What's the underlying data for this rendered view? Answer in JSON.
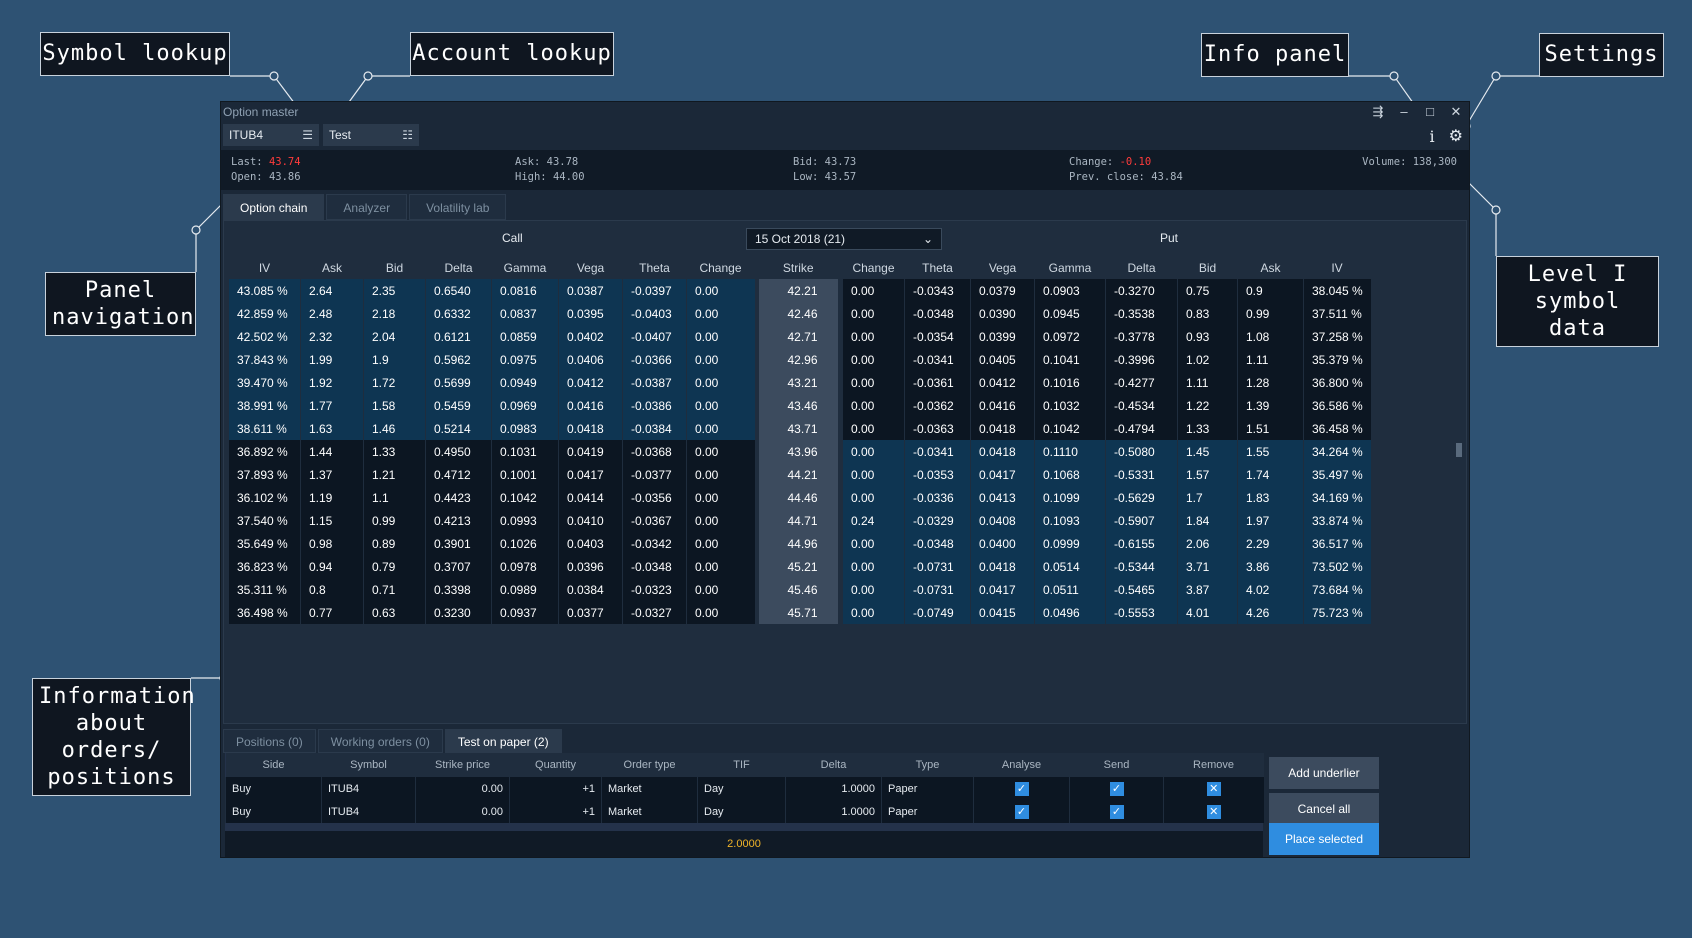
{
  "callouts": {
    "symbol_lookup": "Symbol lookup",
    "account_lookup": "Account lookup",
    "info_panel": "Info panel",
    "settings": "Settings",
    "panel_navigation": [
      "Panel",
      "navigation"
    ],
    "level1": [
      "Level I",
      "symbol data"
    ],
    "orders_info": [
      "Information",
      "about",
      "orders/",
      "positions"
    ]
  },
  "window": {
    "title": "Option master"
  },
  "toolbar": {
    "symbol": "ITUB4",
    "account": "Test",
    "info_icon": "i"
  },
  "quote": {
    "last_label": "Last:",
    "last": "43.74",
    "open_label": "Open:",
    "open": "43.86",
    "ask_label": "Ask:",
    "ask": "43.78",
    "high_label": "High:",
    "high": "44.00",
    "bid_label": "Bid:",
    "bid": "43.73",
    "low_label": "Low:",
    "low": "43.57",
    "change_label": "Change:",
    "change": "-0.10",
    "prev_close_label": "Prev. close:",
    "prev_close": "43.84",
    "volume_label": "Volume:",
    "volume": "138,300"
  },
  "tabs": [
    "Option chain",
    "Analyzer",
    "Volatility lab"
  ],
  "chain": {
    "call_label": "Call",
    "put_label": "Put",
    "expiration": "15 Oct 2018 (21)",
    "call_headers": [
      "IV",
      "Ask",
      "Bid",
      "Delta",
      "Gamma",
      "Vega",
      "Theta",
      "Change"
    ],
    "strike_header": "Strike",
    "put_headers": [
      "Change",
      "Theta",
      "Vega",
      "Gamma",
      "Delta",
      "Bid",
      "Ask",
      "IV"
    ],
    "strikes": [
      "42.21",
      "42.46",
      "42.71",
      "42.96",
      "43.21",
      "43.46",
      "43.71",
      "43.96",
      "44.21",
      "44.46",
      "44.71",
      "44.96",
      "45.21",
      "45.46",
      "45.71"
    ],
    "calls": [
      [
        "43.085 %",
        "2.64",
        "2.35",
        "0.6540",
        "0.0816",
        "0.0387",
        "-0.0397",
        "0.00"
      ],
      [
        "42.859 %",
        "2.48",
        "2.18",
        "0.6332",
        "0.0837",
        "0.0395",
        "-0.0403",
        "0.00"
      ],
      [
        "42.502 %",
        "2.32",
        "2.04",
        "0.6121",
        "0.0859",
        "0.0402",
        "-0.0407",
        "0.00"
      ],
      [
        "37.843 %",
        "1.99",
        "1.9",
        "0.5962",
        "0.0975",
        "0.0406",
        "-0.0366",
        "0.00"
      ],
      [
        "39.470 %",
        "1.92",
        "1.72",
        "0.5699",
        "0.0949",
        "0.0412",
        "-0.0387",
        "0.00"
      ],
      [
        "38.991 %",
        "1.77",
        "1.58",
        "0.5459",
        "0.0969",
        "0.0416",
        "-0.0386",
        "0.00"
      ],
      [
        "38.611 %",
        "1.63",
        "1.46",
        "0.5214",
        "0.0983",
        "0.0418",
        "-0.0384",
        "0.00"
      ],
      [
        "36.892 %",
        "1.44",
        "1.33",
        "0.4950",
        "0.1031",
        "0.0419",
        "-0.0368",
        "0.00"
      ],
      [
        "37.893 %",
        "1.37",
        "1.21",
        "0.4712",
        "0.1001",
        "0.0417",
        "-0.0377",
        "0.00"
      ],
      [
        "36.102 %",
        "1.19",
        "1.1",
        "0.4423",
        "0.1042",
        "0.0414",
        "-0.0356",
        "0.00"
      ],
      [
        "37.540 %",
        "1.15",
        "0.99",
        "0.4213",
        "0.0993",
        "0.0410",
        "-0.0367",
        "0.00"
      ],
      [
        "35.649 %",
        "0.98",
        "0.89",
        "0.3901",
        "0.1026",
        "0.0403",
        "-0.0342",
        "0.00"
      ],
      [
        "36.823 %",
        "0.94",
        "0.79",
        "0.3707",
        "0.0978",
        "0.0396",
        "-0.0348",
        "0.00"
      ],
      [
        "35.311 %",
        "0.8",
        "0.71",
        "0.3398",
        "0.0989",
        "0.0384",
        "-0.0323",
        "0.00"
      ],
      [
        "36.498 %",
        "0.77",
        "0.63",
        "0.3230",
        "0.0937",
        "0.0377",
        "-0.0327",
        "0.00"
      ]
    ],
    "call_colors": [
      [
        "r",
        "r",
        "r",
        "g",
        "g",
        "g",
        "g",
        "w"
      ],
      [
        "r",
        "r",
        "r",
        "g",
        "g",
        "g",
        "g",
        "w"
      ],
      [
        "r",
        "r",
        "r",
        "g",
        "g",
        "g",
        "g",
        "w"
      ],
      [
        "g",
        "w",
        "g",
        "r",
        "r",
        "w",
        "r",
        "w"
      ],
      [
        "g",
        "w",
        "r",
        "r",
        "r",
        "w",
        "r",
        "w"
      ],
      [
        "g",
        "w",
        "r",
        "r",
        "r",
        "w",
        "r",
        "w"
      ],
      [
        "g",
        "w",
        "g",
        "r",
        "r",
        "w",
        "r",
        "w"
      ],
      [
        "g",
        "w",
        "w",
        "r",
        "r",
        "w",
        "r",
        "w"
      ],
      [
        "g",
        "w",
        "w",
        "r",
        "r",
        "r",
        "r",
        "w"
      ],
      [
        "g",
        "w",
        "w",
        "r",
        "r",
        "r",
        "r",
        "w"
      ],
      [
        "g",
        "g",
        "w",
        "g",
        "r",
        "w",
        "r",
        "w"
      ],
      [
        "g",
        "w",
        "w",
        "r",
        "r",
        "w",
        "r",
        "w"
      ],
      [
        "g",
        "w",
        "w",
        "r",
        "r",
        "r",
        "r",
        "w"
      ],
      [
        "g",
        "w",
        "w",
        "r",
        "r",
        "r",
        "r",
        "w"
      ],
      [
        "g",
        "w",
        "w",
        "r",
        "r",
        "r",
        "r",
        "w"
      ]
    ],
    "puts": [
      [
        "0.00",
        "-0.0343",
        "0.0379",
        "0.0903",
        "-0.3270",
        "0.75",
        "0.9",
        "38.045 %"
      ],
      [
        "0.00",
        "-0.0348",
        "0.0390",
        "0.0945",
        "-0.3538",
        "0.83",
        "0.99",
        "37.511 %"
      ],
      [
        "0.00",
        "-0.0354",
        "0.0399",
        "0.0972",
        "-0.3778",
        "0.93",
        "1.08",
        "37.258 %"
      ],
      [
        "0.00",
        "-0.0341",
        "0.0405",
        "0.1041",
        "-0.3996",
        "1.02",
        "1.11",
        "35.379 %"
      ],
      [
        "0.00",
        "-0.0361",
        "0.0412",
        "0.1016",
        "-0.4277",
        "1.11",
        "1.28",
        "36.800 %"
      ],
      [
        "0.00",
        "-0.0362",
        "0.0416",
        "0.1032",
        "-0.4534",
        "1.22",
        "1.39",
        "36.586 %"
      ],
      [
        "0.00",
        "-0.0363",
        "0.0418",
        "0.1042",
        "-0.4794",
        "1.33",
        "1.51",
        "36.458 %"
      ],
      [
        "0.00",
        "-0.0341",
        "0.0418",
        "0.1110",
        "-0.5080",
        "1.45",
        "1.55",
        "34.264 %"
      ],
      [
        "0.00",
        "-0.0353",
        "0.0417",
        "0.1068",
        "-0.5331",
        "1.57",
        "1.74",
        "35.497 %"
      ],
      [
        "0.00",
        "-0.0336",
        "0.0413",
        "0.1099",
        "-0.5629",
        "1.7",
        "1.83",
        "34.169 %"
      ],
      [
        "0.24",
        "-0.0329",
        "0.0408",
        "0.1093",
        "-0.5907",
        "1.84",
        "1.97",
        "33.874 %"
      ],
      [
        "0.00",
        "-0.0348",
        "0.0400",
        "0.0999",
        "-0.6155",
        "2.06",
        "2.29",
        "36.517 %"
      ],
      [
        "0.00",
        "-0.0731",
        "0.0418",
        "0.0514",
        "-0.5344",
        "3.71",
        "3.86",
        "73.502 %"
      ],
      [
        "0.00",
        "-0.0731",
        "0.0417",
        "0.0511",
        "-0.5465",
        "3.87",
        "4.02",
        "73.684 %"
      ],
      [
        "0.00",
        "-0.0749",
        "0.0415",
        "0.0496",
        "-0.5553",
        "4.01",
        "4.26",
        "75.723 %"
      ]
    ],
    "put_colors": [
      [
        "w",
        "w",
        "w",
        "w",
        "w",
        "w",
        "w",
        "w"
      ],
      [
        "w",
        "g",
        "g",
        "g",
        "r",
        "r",
        "g",
        "r"
      ],
      [
        "w",
        "r",
        "g",
        "w",
        "r",
        "w",
        "g",
        "w"
      ],
      [
        "w",
        "g",
        "w",
        "g",
        "r",
        "w",
        "w",
        "r"
      ],
      [
        "w",
        "r",
        "g",
        "w",
        "r",
        "r",
        "g",
        "w"
      ],
      [
        "w",
        "w",
        "w",
        "w",
        "r",
        "w",
        "g",
        "w"
      ],
      [
        "w",
        "g",
        "w",
        "g",
        "r",
        "w",
        "g",
        "r"
      ],
      [
        "w",
        "g",
        "r",
        "g",
        "r",
        "w",
        "w",
        "r"
      ],
      [
        "w",
        "g",
        "r",
        "g",
        "r",
        "w",
        "r",
        "r"
      ],
      [
        "w",
        "g",
        "r",
        "w",
        "r",
        "w",
        "g",
        "r"
      ],
      [
        "w",
        "g",
        "w",
        "w",
        "r",
        "w",
        "g",
        "r"
      ],
      [
        "w",
        "w",
        "w",
        "w",
        "w",
        "w",
        "w",
        "w"
      ],
      [
        "w",
        "w",
        "w",
        "w",
        "w",
        "w",
        "w",
        "w"
      ],
      [
        "w",
        "w",
        "w",
        "w",
        "w",
        "w",
        "w",
        "w"
      ],
      [
        "w",
        "w",
        "w",
        "w",
        "w",
        "w",
        "w",
        "w"
      ]
    ],
    "itm_call_rows": 7
  },
  "bottom_tabs": [
    "Positions (0)",
    "Working orders (0)",
    "Test on paper (2)"
  ],
  "orders": {
    "headers": [
      "Side",
      "Symbol",
      "Strike price",
      "Quantity",
      "Order type",
      "TIF",
      "Delta",
      "Type",
      "Analyse",
      "Send",
      "Remove"
    ],
    "rows": [
      {
        "side": "Buy",
        "symbol": "ITUB4",
        "strike": "0.00",
        "qty": "+1",
        "otype": "Market",
        "tif": "Day",
        "delta": "1.0000",
        "type": "Paper"
      },
      {
        "side": "Buy",
        "symbol": "ITUB4",
        "strike": "0.00",
        "qty": "+1",
        "otype": "Market",
        "tif": "Day",
        "delta": "1.0000",
        "type": "Paper"
      }
    ],
    "total_delta": "2.0000"
  },
  "buttons": {
    "add_underlier": "Add underlier",
    "cancel_all": "Cancel all",
    "place_selected": "Place selected"
  }
}
